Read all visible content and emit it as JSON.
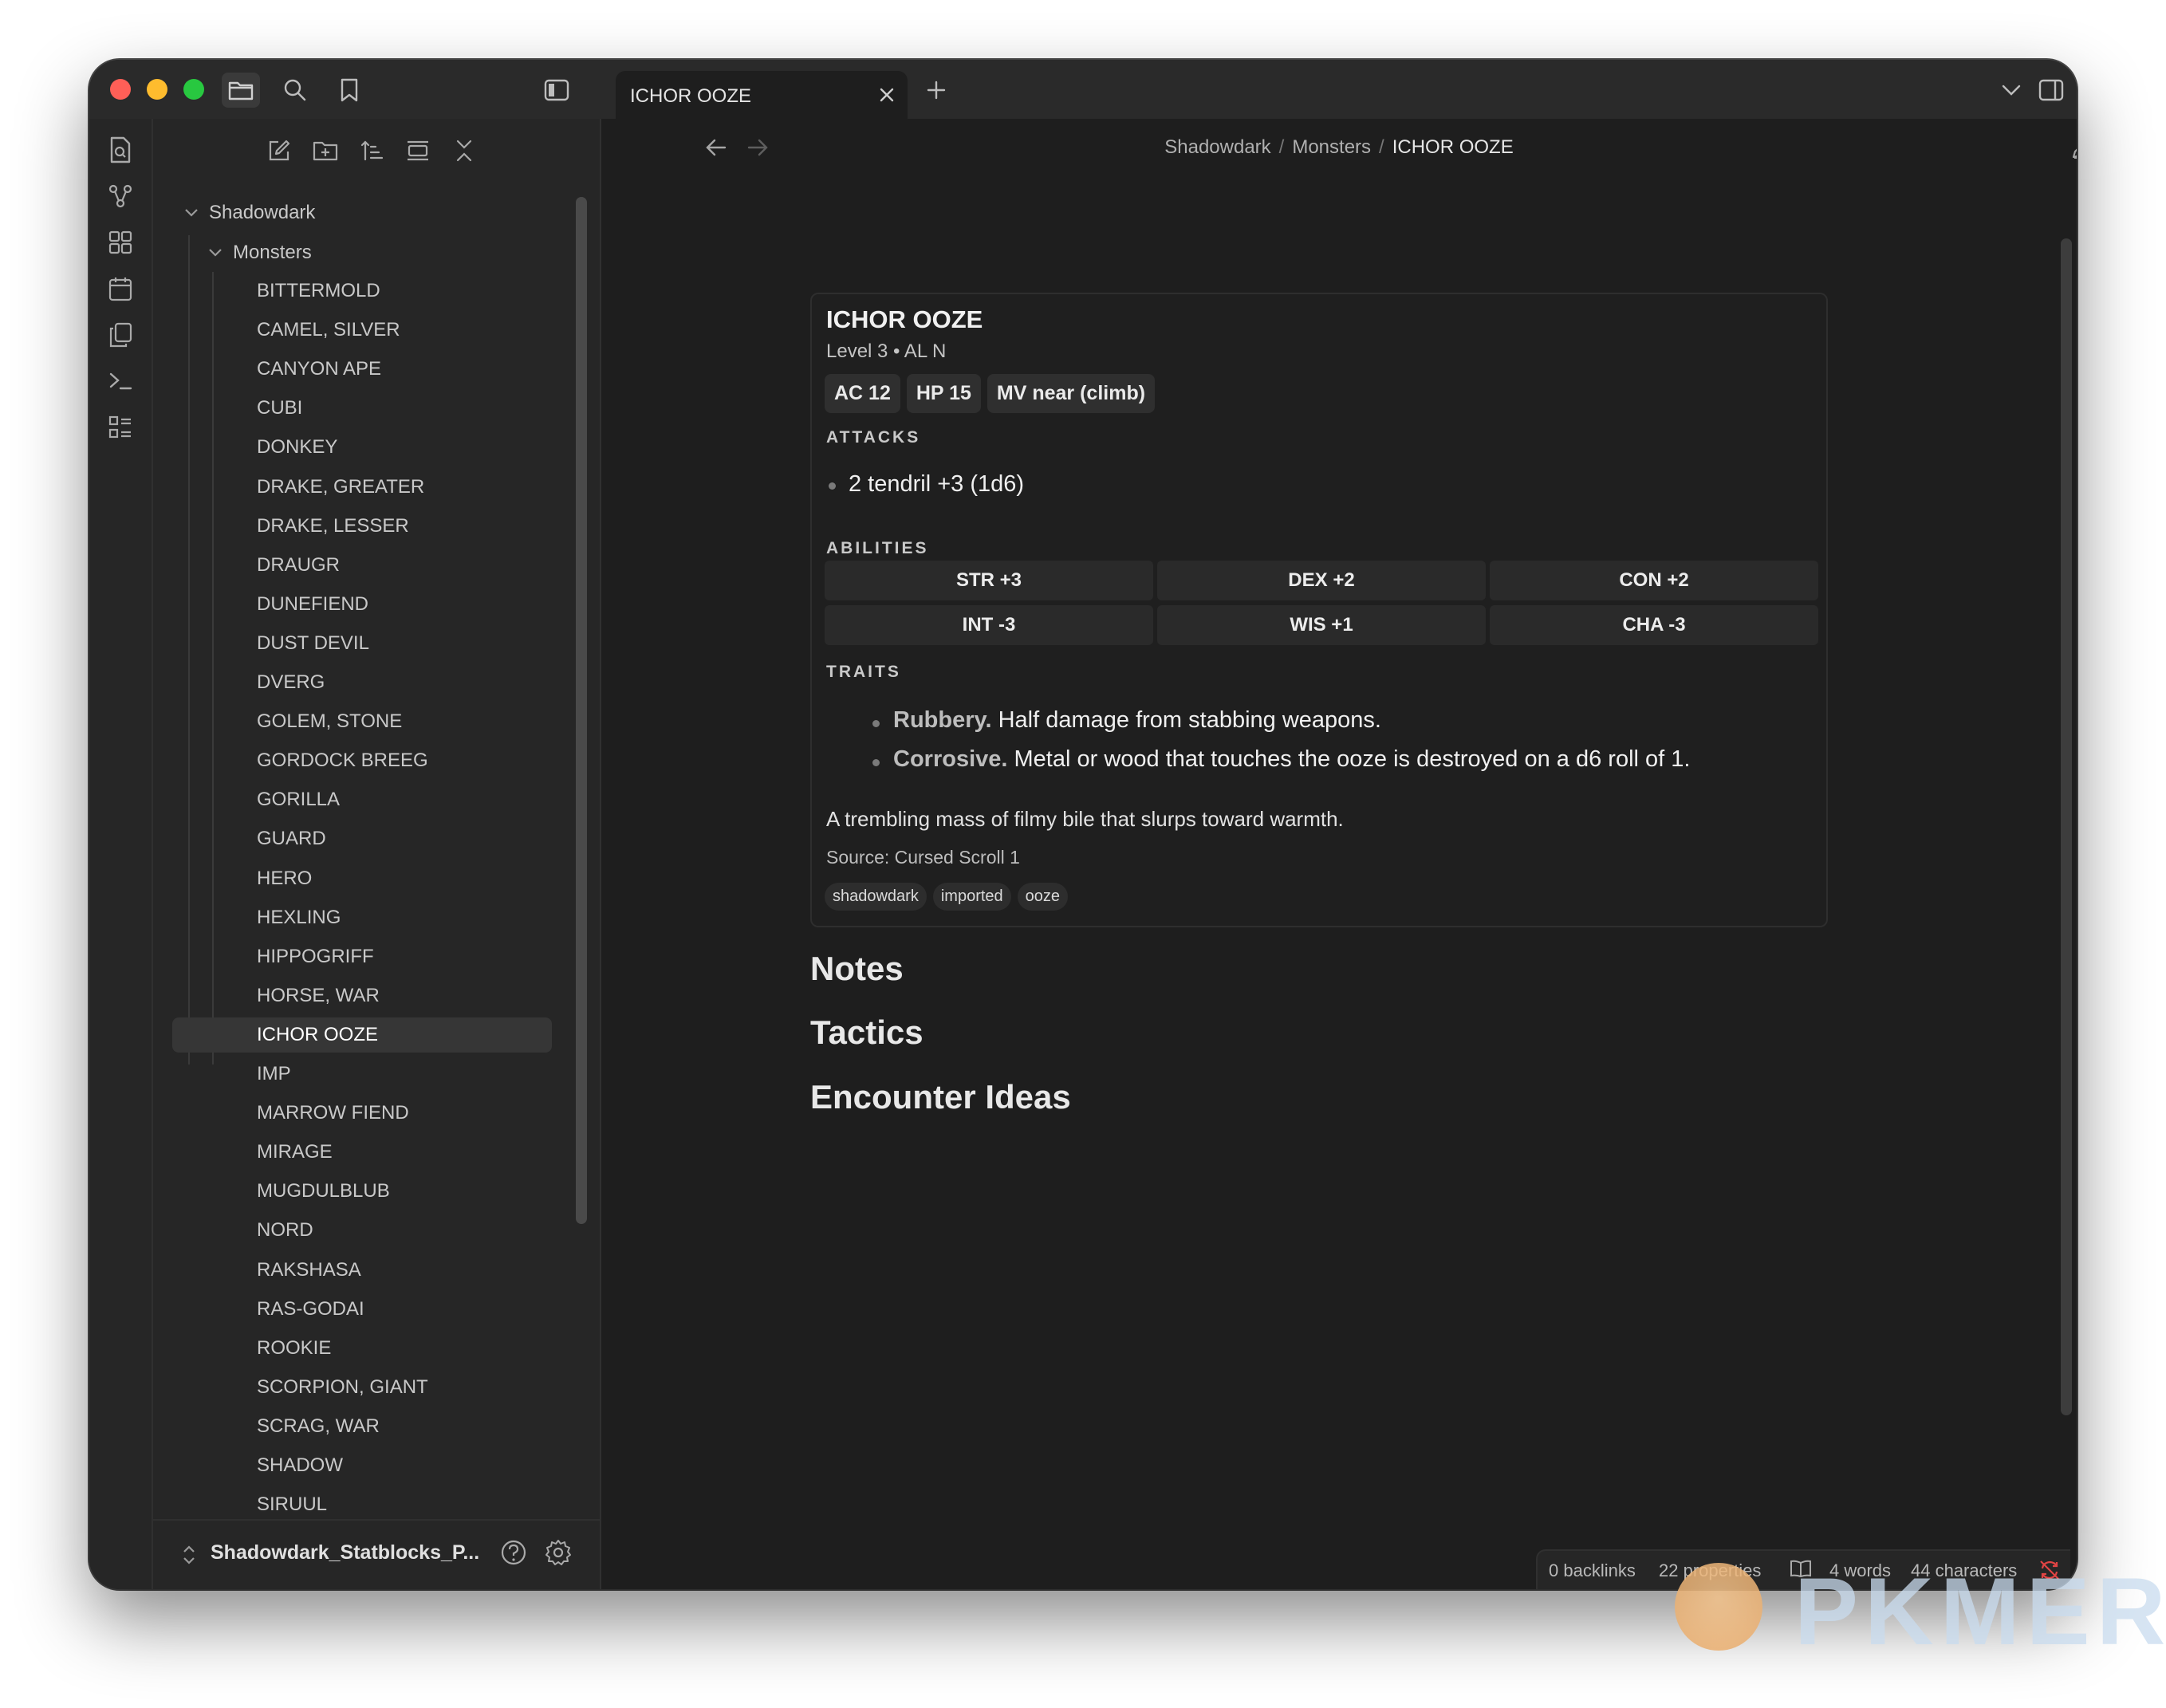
{
  "tab": {
    "title": "ICHOR OOZE"
  },
  "breadcrumb": {
    "root": "Shadowdark",
    "folder": "Monsters",
    "current": "ICHOR OOZE",
    "separator": "/"
  },
  "tree": {
    "root": "Shadowdark",
    "folder": "Monsters",
    "selected": "ICHOR OOZE",
    "files": [
      "BITTERMOLD",
      "CAMEL, SILVER",
      "CANYON APE",
      "CUBI",
      "DONKEY",
      "DRAKE, GREATER",
      "DRAKE, LESSER",
      "DRAUGR",
      "DUNEFIEND",
      "DUST DEVIL",
      "DVERG",
      "GOLEM, STONE",
      "GORDOCK BREEG",
      "GORILLA",
      "GUARD",
      "HERO",
      "HEXLING",
      "HIPPOGRIFF",
      "HORSE, WAR",
      "ICHOR OOZE",
      "IMP",
      "MARROW FIEND",
      "MIRAGE",
      "MUGDULBLUB",
      "NORD",
      "RAKSHASA",
      "RAS-GODAI",
      "ROOKIE",
      "SCORPION, GIANT",
      "SCRAG, WAR",
      "SHADOW",
      "SIRUUL"
    ]
  },
  "vault": {
    "name": "Shadowdark_Statblocks_P..."
  },
  "statblock": {
    "name": "ICHOR OOZE",
    "subtitle": "Level 3 • AL N",
    "pills": {
      "ac": "AC 12",
      "hp": "HP 15",
      "mv": "MV near (climb)"
    },
    "attacks_heading": "ATTACKS",
    "attack": "2 tendril +3 (1d6)",
    "abilities_heading": "ABILITIES",
    "abilities": {
      "str": "STR +3",
      "dex": "DEX +2",
      "con": "CON +2",
      "int": "INT -3",
      "wis": "WIS +1",
      "cha": "CHA -3"
    },
    "traits_heading": "TRAITS",
    "traits": [
      {
        "name": "Rubbery.",
        "text": " Half damage from stabbing weapons."
      },
      {
        "name": "Corrosive.",
        "text": " Metal or wood that touches the ooze is destroyed on a d6 roll of 1."
      }
    ],
    "description": "A trembling mass of filmy bile that slurps toward warmth.",
    "source": "Source: Cursed Scroll 1",
    "tags": [
      "shadowdark",
      "imported",
      "ooze"
    ]
  },
  "headings": {
    "notes": "Notes",
    "tactics": "Tactics",
    "encounter": "Encounter Ideas"
  },
  "status": {
    "backlinks": "0 backlinks",
    "properties": "22 properties",
    "words": "4 words",
    "characters": "44 characters"
  },
  "watermark": {
    "text": "PKMER"
  },
  "colors": {
    "background": "#1e1e1e",
    "sidebar": "#262626",
    "accent_red": "#e04444",
    "selected_row": "#363636"
  }
}
